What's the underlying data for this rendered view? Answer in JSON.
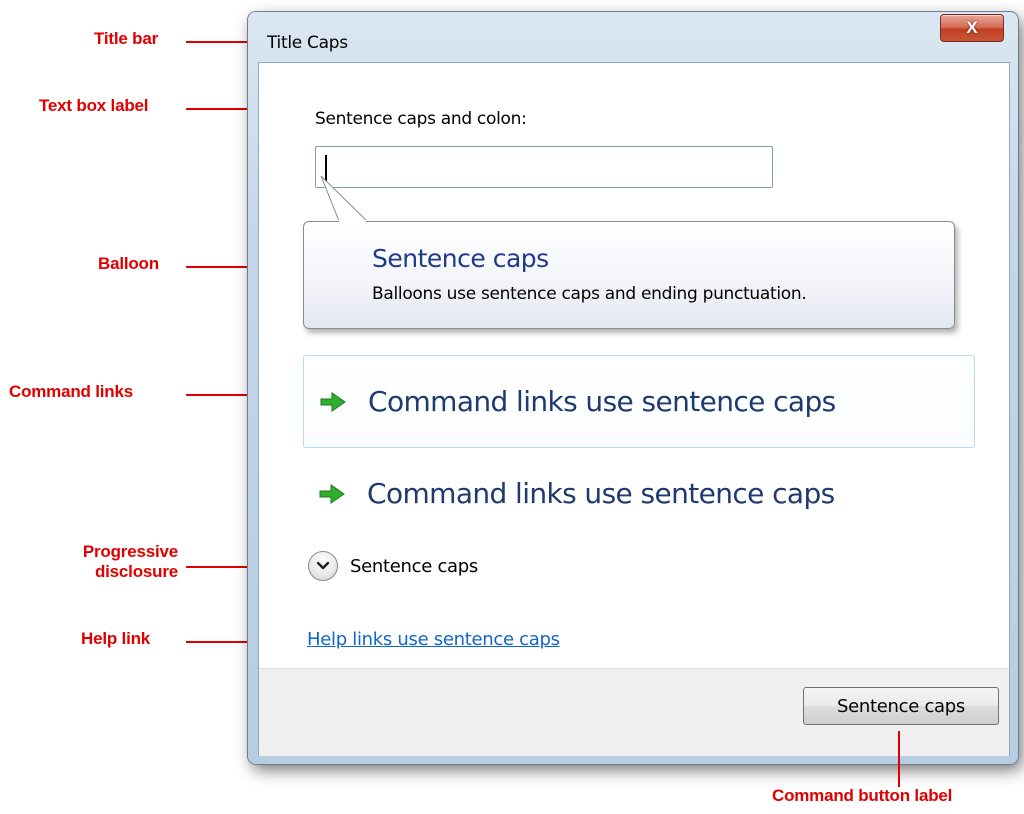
{
  "annotations": {
    "title_bar": "Title bar",
    "text_box_label": "Text box label",
    "balloon": "Balloon",
    "command_links": "Command links",
    "progressive_disclosure_line1": "Progressive",
    "progressive_disclosure_line2": "disclosure",
    "help_link": "Help link",
    "command_button_label": "Command button label"
  },
  "window": {
    "title": "Title Caps",
    "close_glyph": "X"
  },
  "form": {
    "label": "Sentence caps and colon:",
    "input_value": ""
  },
  "balloon": {
    "title": "Sentence caps",
    "body": "Balloons use sentence caps and ending punctuation."
  },
  "command_links": [
    {
      "label": "Command links use sentence  caps",
      "state": "hover",
      "icon": "green-arrow-icon"
    },
    {
      "label": "Command links use sentence  caps",
      "state": "normal",
      "icon": "green-arrow-icon"
    }
  ],
  "disclosure": {
    "label": "Sentence caps",
    "icon": "chevron-down-icon"
  },
  "help_link": "Help links use sentence caps",
  "command_button": "Sentence caps",
  "colors": {
    "annotation": "#e00000",
    "balloon_title": "#1e3a8a",
    "command_link_text": "#1e3a6e",
    "command_arrow": "#2fae2f",
    "help_link": "#0f66cc"
  }
}
